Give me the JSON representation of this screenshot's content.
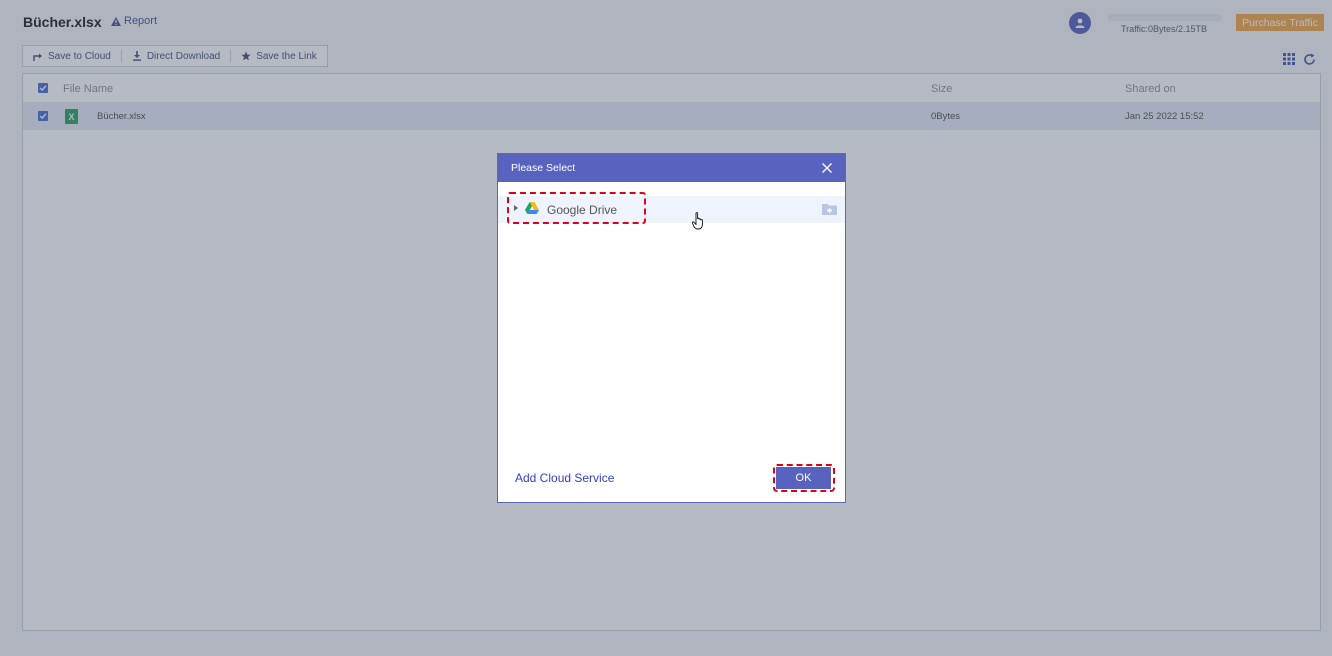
{
  "header": {
    "file_title": "Bücher.xlsx",
    "report_label": "Report",
    "traffic_text": "Traffic:0Bytes/2.15TB",
    "traffic_used_fraction": 0,
    "purchase_label": "Purchase Traffic"
  },
  "toolbar": {
    "save_to_cloud": "Save to Cloud",
    "direct_download": "Direct Download",
    "save_the_link": "Save the Link"
  },
  "table": {
    "columns": {
      "name": "File Name",
      "size": "Size",
      "shared": "Shared on"
    },
    "rows": [
      {
        "name": "Bücher.xlsx",
        "size": "0Bytes",
        "shared": "Jan 25 2022 15:52",
        "type_letter": "X"
      }
    ]
  },
  "dialog": {
    "title": "Please Select",
    "tree": [
      {
        "label": "Google Drive",
        "icon": "google-drive-icon"
      }
    ],
    "add_cloud_service": "Add Cloud Service",
    "ok_label": "OK"
  },
  "colors": {
    "accent": "#5763bf",
    "purchase": "#f0a23b",
    "highlight": "#e0001b",
    "xls": "#1f9e5a"
  }
}
